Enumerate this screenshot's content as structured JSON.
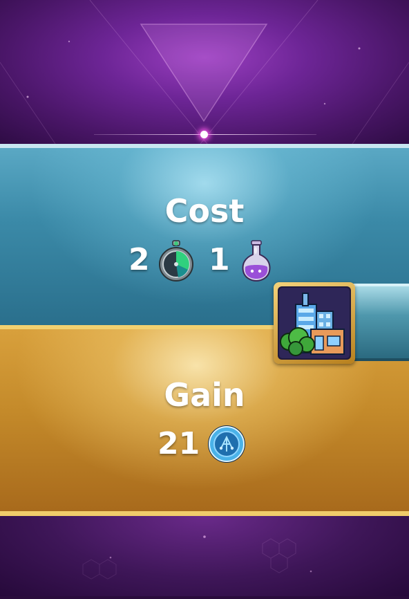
{
  "cost": {
    "title": "Cost",
    "time_amount": "2",
    "time_icon": "stopwatch-icon",
    "potion_amount": "1",
    "potion_icon": "potion-flask-icon"
  },
  "gain": {
    "title": "Gain",
    "amount": "21",
    "icon": "blue-tech-coin-icon"
  },
  "building": {
    "icon": "city-building-icon"
  },
  "colors": {
    "top_purple": "#7a2ea6",
    "cost_panel": "#3b8aa8",
    "gain_panel": "#c48a2a",
    "slider_glow": "#ff5cf0"
  }
}
